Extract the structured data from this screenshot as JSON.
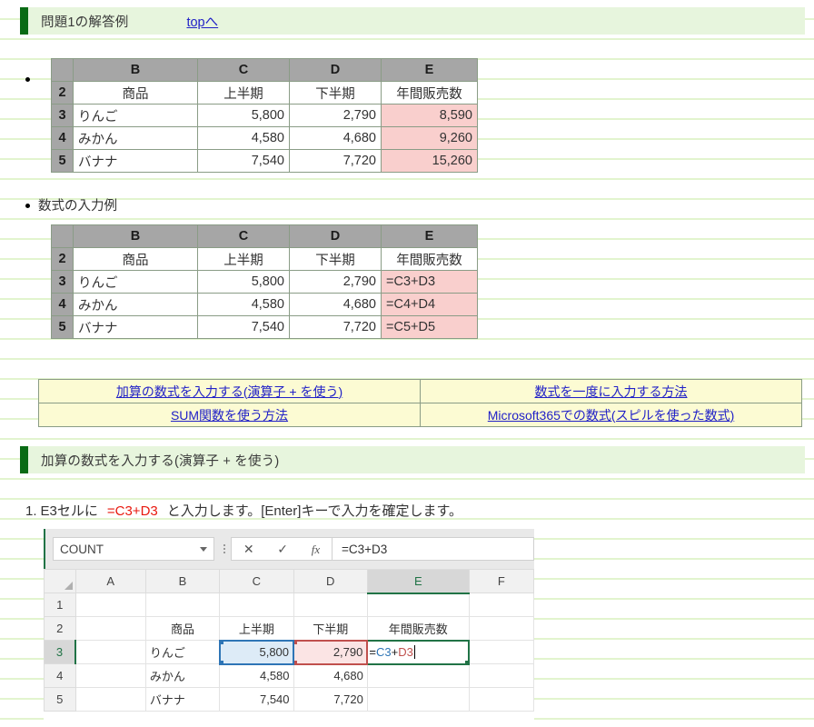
{
  "page": {
    "header": {
      "title": "問題1の解答例",
      "top_link": "topへ"
    },
    "section2_title": "加算の数式を入力する(演算子 + を使う)"
  },
  "answer_table": {
    "caption": "",
    "columns": [
      "",
      "B",
      "C",
      "D",
      "E"
    ],
    "rows": [
      {
        "num": "2",
        "cells": [
          "商品",
          "上半期",
          "下半期",
          "年間販売数"
        ]
      },
      {
        "num": "3",
        "cells": [
          "りんご",
          "5,800",
          "2,790",
          "8,590"
        ]
      },
      {
        "num": "4",
        "cells": [
          "みかん",
          "4,580",
          "4,680",
          "9,260"
        ]
      },
      {
        "num": "5",
        "cells": [
          "バナナ",
          "7,540",
          "7,720",
          "15,260"
        ]
      }
    ]
  },
  "formula_example": {
    "bullet_label": "数式の入力例",
    "columns": [
      "",
      "B",
      "C",
      "D",
      "E"
    ],
    "rows": [
      {
        "num": "2",
        "cells": [
          "商品",
          "上半期",
          "下半期",
          "年間販売数"
        ]
      },
      {
        "num": "3",
        "cells": [
          "りんご",
          "5,800",
          "2,790",
          "=C3+D3"
        ]
      },
      {
        "num": "4",
        "cells": [
          "みかん",
          "4,580",
          "4,680",
          "=C4+D4"
        ]
      },
      {
        "num": "5",
        "cells": [
          "バナナ",
          "7,540",
          "7,720",
          "=C5+D5"
        ]
      }
    ]
  },
  "nav_table": {
    "links": [
      "加算の数式を入力する(演算子 + を使う)",
      "数式を一度に入力する方法",
      "SUM関数を使う方法",
      "Microsoft365での数式(スピルを使った数式)"
    ]
  },
  "step": {
    "number": "1.",
    "before": "E3セルに",
    "formula": "=C3+D3",
    "after": "と入力します。[Enter]キーで入力を確定します。"
  },
  "excel": {
    "name_box": "COUNT",
    "cancel_icon": "✕",
    "confirm_icon": "✓",
    "fx_icon": "fx",
    "formula_bar": "=C3+D3",
    "columns": [
      "A",
      "B",
      "C",
      "D",
      "E",
      "F"
    ],
    "active_column": "E",
    "active_row": "3",
    "rows": [
      {
        "num": "1",
        "A": "",
        "B": "",
        "C": "",
        "D": "",
        "E": "",
        "F": ""
      },
      {
        "num": "2",
        "A": "",
        "B": "商品",
        "C": "上半期",
        "D": "下半期",
        "E": "年間販売数",
        "F": ""
      },
      {
        "num": "3",
        "A": "",
        "B": "りんご",
        "C": "5,800",
        "D": "2,790",
        "E": "=C3+D3",
        "F": ""
      },
      {
        "num": "4",
        "A": "",
        "B": "みかん",
        "C": "4,580",
        "D": "4,680",
        "E": "",
        "F": ""
      },
      {
        "num": "5",
        "A": "",
        "B": "バナナ",
        "C": "7,540",
        "D": "7,720",
        "E": "",
        "F": ""
      }
    ],
    "editing_parts": {
      "eq": "=",
      "ref1": "C3",
      "op": "+",
      "ref2": "D3"
    }
  },
  "colors": {
    "section_bar_accent": "#0a6b15",
    "section_bar_bg": "#e7f5dd",
    "link": "#2121c7",
    "header_gray": "#a6a6a6",
    "result_pink": "#f9cfcd",
    "nav_yellow": "#fcfbd3",
    "excel_green": "#217346",
    "ref_blue": "#2e75b6",
    "ref_red": "#c0504d",
    "formula_red": "#e8190f"
  }
}
